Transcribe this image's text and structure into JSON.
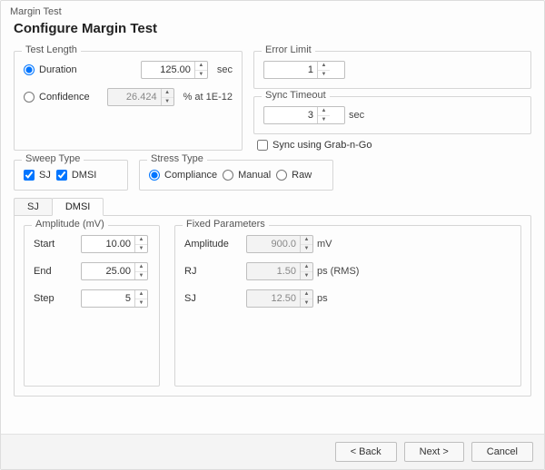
{
  "window": {
    "title": "Margin Test"
  },
  "heading": "Configure Margin Test",
  "testLength": {
    "legend": "Test Length",
    "duration": {
      "label": "Duration",
      "value": "125.00",
      "unit": "sec",
      "selected": true
    },
    "confidence": {
      "label": "Confidence",
      "value": "26.424",
      "unit": "% at 1E-12",
      "selected": false
    }
  },
  "errorLimit": {
    "legend": "Error Limit",
    "value": "1"
  },
  "syncTimeout": {
    "legend": "Sync Timeout",
    "value": "3",
    "unit": "sec"
  },
  "syncGrab": {
    "label": "Sync using Grab-n-Go",
    "checked": false
  },
  "sweepType": {
    "legend": "Sweep Type",
    "sj": {
      "label": "SJ",
      "checked": true
    },
    "dmsi": {
      "label": "DMSI",
      "checked": true
    }
  },
  "stressType": {
    "legend": "Stress Type",
    "options": [
      {
        "label": "Compliance",
        "selected": true
      },
      {
        "label": "Manual",
        "selected": false
      },
      {
        "label": "Raw",
        "selected": false
      }
    ]
  },
  "tabs": {
    "sj": "SJ",
    "dmsi": "DMSI",
    "active": "dmsi"
  },
  "amplitude": {
    "legend": "Amplitude (mV)",
    "start": {
      "label": "Start",
      "value": "10.00"
    },
    "end": {
      "label": "End",
      "value": "25.00"
    },
    "step": {
      "label": "Step",
      "value": "5"
    }
  },
  "fixed": {
    "legend": "Fixed Parameters",
    "amp": {
      "label": "Amplitude",
      "value": "900.0",
      "unit": "mV"
    },
    "rj": {
      "label": "RJ",
      "value": "1.50",
      "unit": "ps (RMS)"
    },
    "sj": {
      "label": "SJ",
      "value": "12.50",
      "unit": "ps"
    }
  },
  "footer": {
    "back": "< Back",
    "next": "Next >",
    "cancel": "Cancel"
  }
}
